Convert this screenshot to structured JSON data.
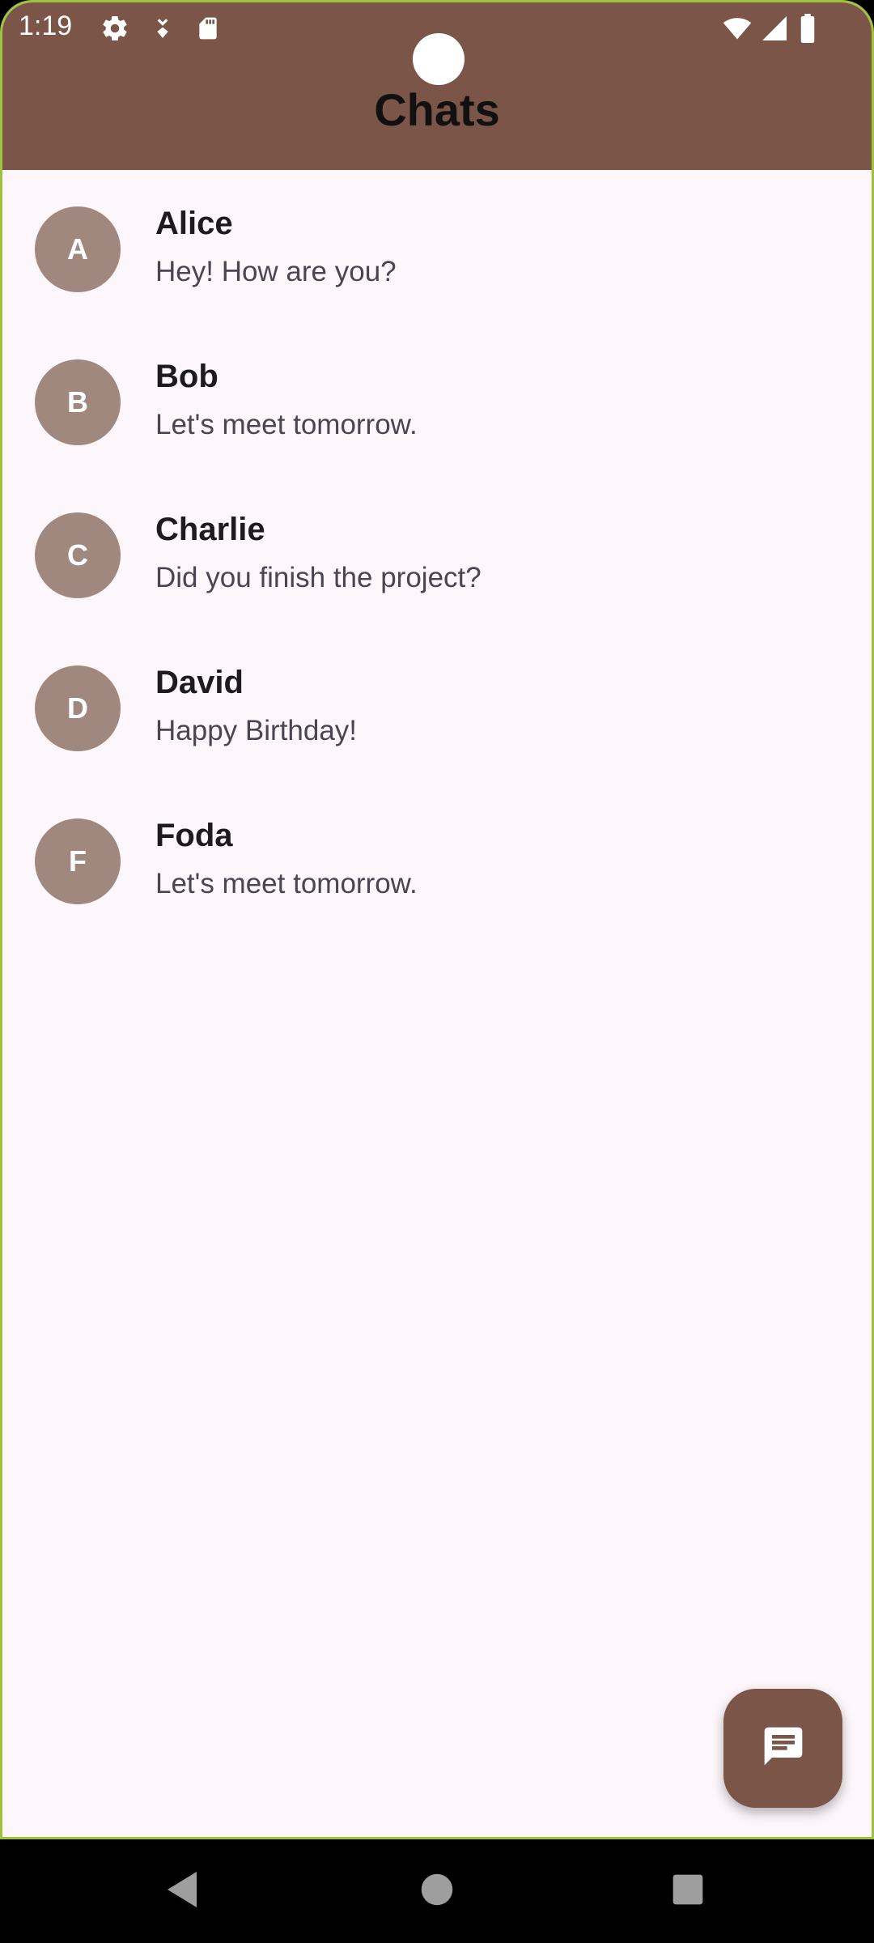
{
  "status_bar": {
    "time": "1:19",
    "left_icons": [
      "gear-icon",
      "download-icon",
      "sd-card-icon"
    ],
    "right_icons": [
      "wifi-icon",
      "signal-icon",
      "battery-icon"
    ]
  },
  "app_bar": {
    "title": "Chats",
    "color": "#7a5548"
  },
  "chats": [
    {
      "initial": "A",
      "name": "Alice",
      "message": "Hey! How are you?"
    },
    {
      "initial": "B",
      "name": "Bob",
      "message": "Let's meet tomorrow."
    },
    {
      "initial": "C",
      "name": "Charlie",
      "message": "Did you finish the project?"
    },
    {
      "initial": "D",
      "name": "David",
      "message": "Happy Birthday!"
    },
    {
      "initial": "F",
      "name": "Foda",
      "message": "Let's meet tomorrow."
    }
  ],
  "fab": {
    "icon": "message-icon"
  },
  "nav_bar": {
    "buttons": [
      "back-icon",
      "home-icon",
      "recents-icon"
    ]
  },
  "colors": {
    "accent": "#7a5548",
    "avatar": "#a1887f",
    "background": "#fdf7fc"
  }
}
